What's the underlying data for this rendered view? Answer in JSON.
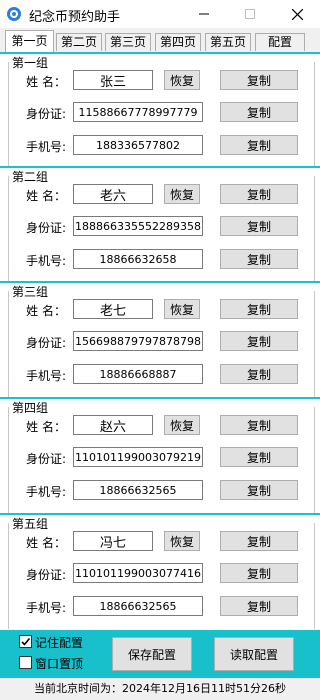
{
  "window": {
    "title": "纪念币预约助手"
  },
  "tabs": [
    "第一页",
    "第二页",
    "第三页",
    "第四页",
    "第五页",
    "配置"
  ],
  "labels": {
    "name": "姓 名：",
    "id": "身份证:",
    "phone": "手机号:"
  },
  "buttons": {
    "restore": "恢复",
    "copy": "复制"
  },
  "groups": [
    {
      "title": "第一组",
      "name": "张三",
      "id": "11588667778997779",
      "phone": "188336577802"
    },
    {
      "title": "第二组",
      "name": "老六",
      "id": "188866335552289358",
      "phone": "18866632658"
    },
    {
      "title": "第三组",
      "name": "老七",
      "id": "156698879797878798",
      "phone": "18886668887"
    },
    {
      "title": "第四组",
      "name": "赵六",
      "id": "110101199003079219",
      "phone": "18866632565"
    },
    {
      "title": "第五组",
      "name": "冯七",
      "id": "110101199003077416",
      "phone": "18866632565"
    }
  ],
  "footer": {
    "remember_label": "记住配置",
    "remember_checked": true,
    "ontop_label": "窗口置顶",
    "ontop_checked": false,
    "save_label": "保存配置",
    "load_label": "读取配置"
  },
  "status": {
    "text": "当前北京时间为：2024年12月16日11时51分26秒"
  },
  "colors": {
    "accent": "#18c0cc",
    "icon_blue": "#2f7fd8"
  }
}
